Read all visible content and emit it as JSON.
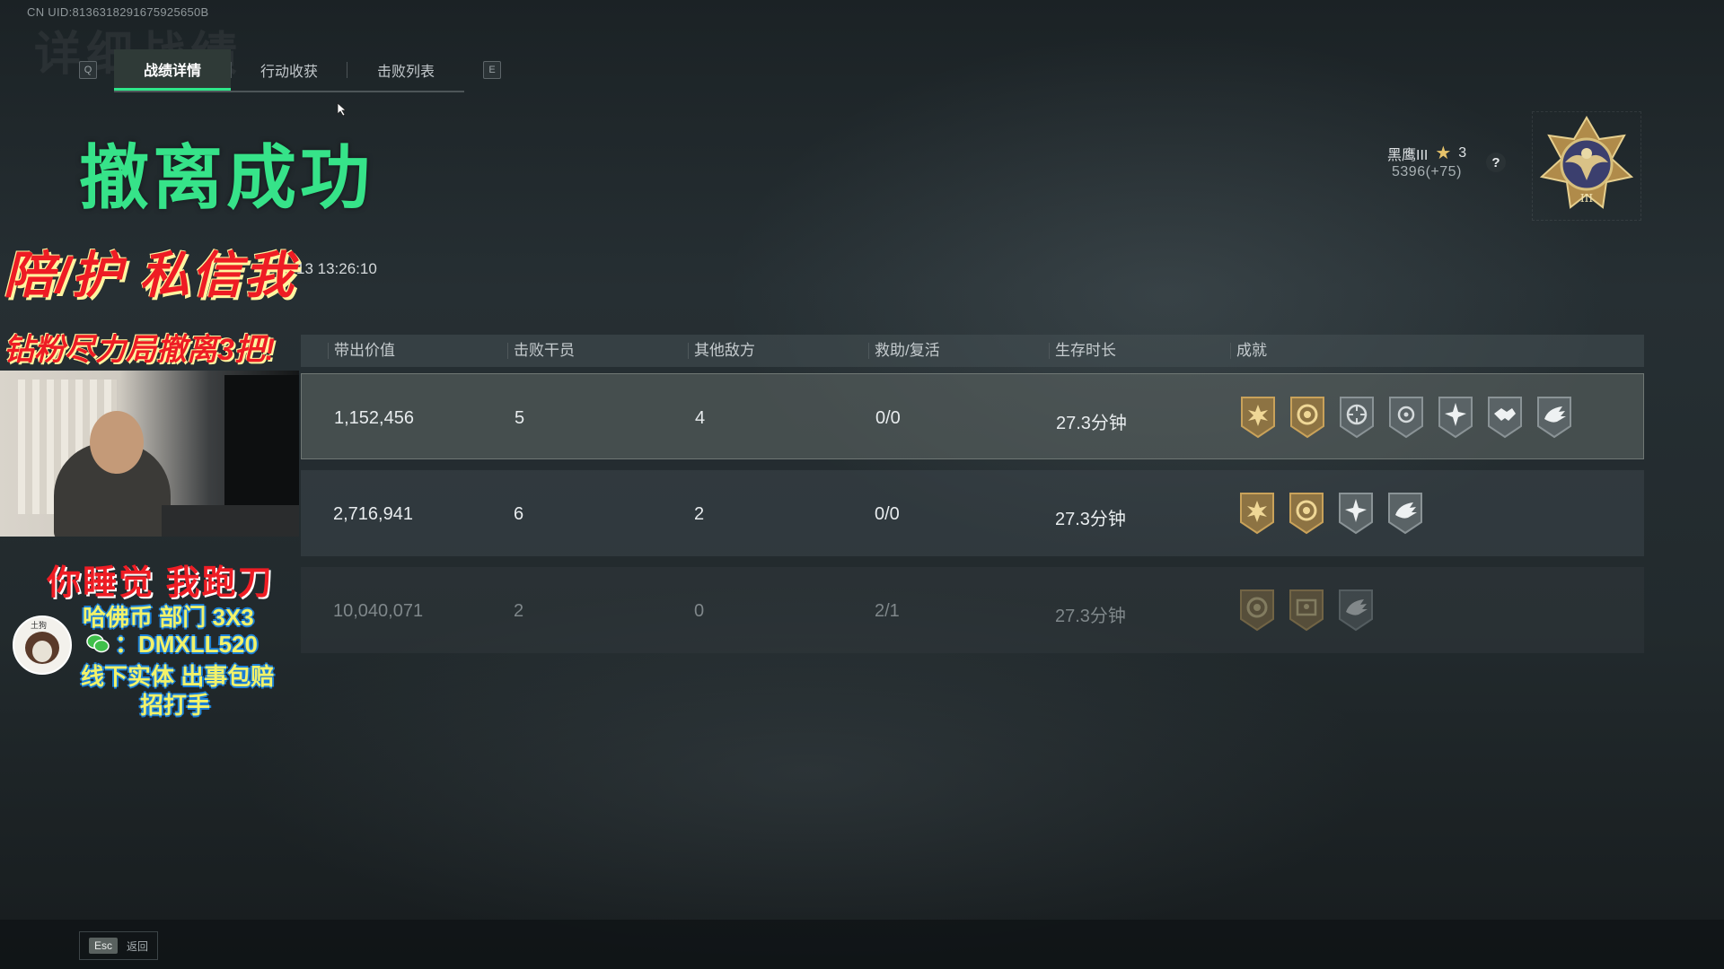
{
  "header": {
    "uid": "CN UID:8136318291675925650B",
    "left_key": "Q",
    "right_key": "E",
    "tabs": [
      {
        "label": "战绩详情",
        "active": true
      },
      {
        "label": "行动收获",
        "active": false
      },
      {
        "label": "击败列表",
        "active": false
      }
    ]
  },
  "result": {
    "title": "撤离成功",
    "timestamp": "13 13:26:10"
  },
  "rank": {
    "name": "黑鹰III",
    "stars": "3",
    "points": "5396(+75)",
    "help_symbol": "?"
  },
  "table": {
    "columns": [
      "带出价值",
      "击败干员",
      "其他敌方",
      "救助/复活",
      "生存时长",
      "成就"
    ],
    "rows": [
      {
        "value": "1,152,456",
        "kills": "5",
        "other": "4",
        "assist": "0/0",
        "time": "27.3分钟",
        "achievements": [
          "burst-badge-icon",
          "coin-badge-icon",
          "target-cycle-icon",
          "crosshair-icon",
          "star-burst-icon",
          "handshake-icon",
          "wing-icon"
        ]
      },
      {
        "value": "2,716,941",
        "kills": "6",
        "other": "2",
        "assist": "0/0",
        "time": "27.3分钟",
        "achievements": [
          "burst-badge-icon",
          "coin-badge-icon",
          "star-burst-icon",
          "wing-icon"
        ]
      },
      {
        "value": "10,040,071",
        "kills": "2",
        "other": "0",
        "assist": "2/1",
        "time": "27.3分钟",
        "achievements": [
          "coin-badge-icon",
          "card-badge-icon",
          "wing-icon"
        ]
      }
    ]
  },
  "overlay": {
    "promo1": "陪/护 私信我",
    "promo2": "钻粉尽力局撤离3把!",
    "sleep": "你睡觉 我跑刀",
    "hafu": "哈佛币  部门  3X3",
    "wechat": "：DMXLL520",
    "offline": "线下实体 出事包赔",
    "hire": "招打手",
    "avatar_tag": "土狗"
  },
  "footer": {
    "esc_key": "Esc",
    "back_label": "返回"
  },
  "colors": {
    "success_green": "#36e389",
    "tab_accent": "#2ee78a",
    "gold_badge": "#c9a25a",
    "silver_badge": "#8a9396",
    "promo_red": "#ee1c24"
  }
}
